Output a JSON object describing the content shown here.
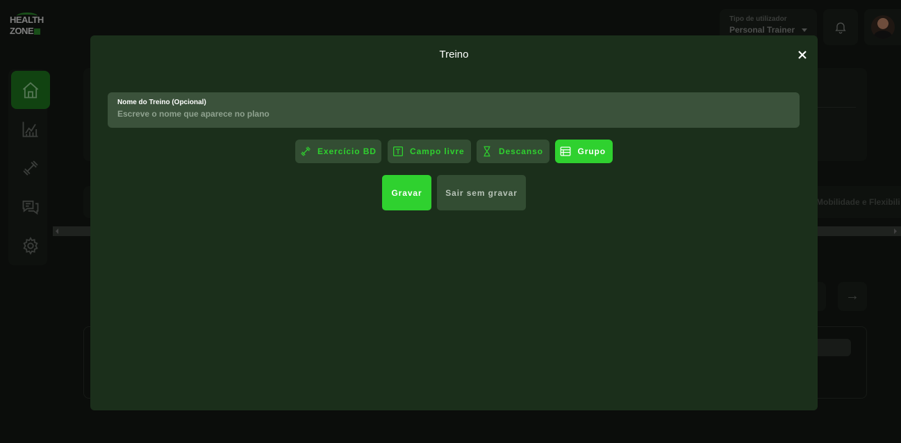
{
  "app": {
    "logo_line1": "HEALTH",
    "logo_line2": "ZONE"
  },
  "header": {
    "user_type_label": "Tipo de utilizador",
    "user_type_value": "Personal Trainer"
  },
  "background": {
    "tab_right_label": "Mobilidade e Flexibili"
  },
  "sidebar": {
    "items": [
      {
        "name": "home",
        "icon": "home-icon",
        "active": true
      },
      {
        "name": "statistics",
        "icon": "chart-icon",
        "active": false
      },
      {
        "name": "workouts",
        "icon": "dumbbell-icon",
        "active": false
      },
      {
        "name": "messages",
        "icon": "chat-icon",
        "active": false
      },
      {
        "name": "settings",
        "icon": "gear-icon",
        "active": false
      }
    ]
  },
  "modal": {
    "title": "Treino",
    "name_field": {
      "label": "Nome do Treino (Opcional)",
      "placeholder": "Escreve o nome que aparece no plano",
      "value": ""
    },
    "tools": [
      {
        "label": "Exercício BD",
        "icon": "dumbbell-icon",
        "active": false
      },
      {
        "label": "Campo livre",
        "icon": "text-box-icon",
        "active": false
      },
      {
        "label": "Descanso",
        "icon": "hourglass-icon",
        "active": false
      },
      {
        "label": "Grupo",
        "icon": "table-icon",
        "active": true
      }
    ],
    "save_label": "Gravar",
    "exit_label": "Sair sem gravar"
  },
  "colors": {
    "accent": "#2fd12f",
    "modal_bg": "#1b2f1b",
    "input_bg": "#3b523b",
    "button_bg": "#334d33"
  }
}
